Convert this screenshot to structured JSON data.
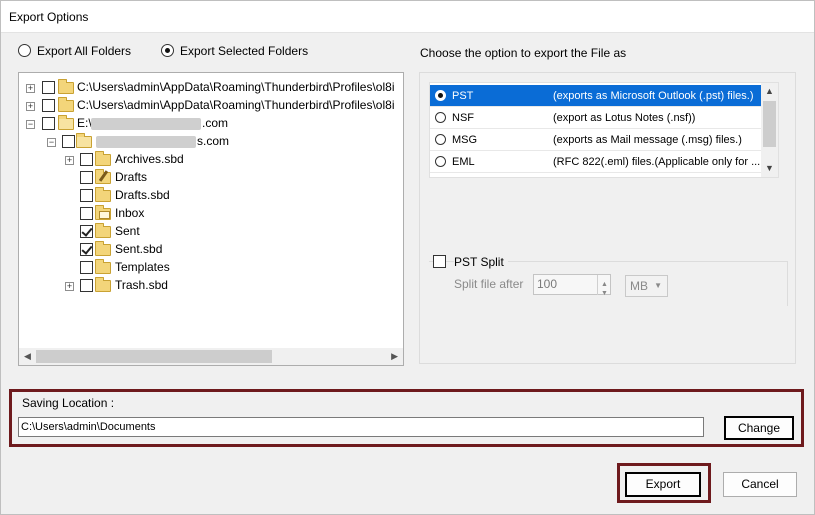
{
  "window": {
    "title": "Export Options"
  },
  "folders_mode": {
    "options": [
      {
        "label": "Export All Folders",
        "selected": false
      },
      {
        "label": "Export Selected Folders",
        "selected": true
      }
    ]
  },
  "tree": {
    "nodes": [
      {
        "label": "C:\\Users\\admin\\AppData\\Roaming\\Thunderbird\\Profiles\\ol8i",
        "checked": false,
        "expander": "+"
      },
      {
        "label": "C:\\Users\\admin\\AppData\\Roaming\\Thunderbird\\Profiles\\ol8i",
        "checked": false,
        "expander": "+"
      },
      {
        "label_prefix": "E:\\",
        "label_suffix": ".com",
        "checked": false,
        "expander": "−"
      },
      {
        "label_suffix": "s.com",
        "checked": false,
        "expander": "−"
      },
      {
        "label": "Archives.sbd",
        "checked": false,
        "expander": "+"
      },
      {
        "label": "Drafts",
        "checked": false
      },
      {
        "label": "Drafts.sbd",
        "checked": false
      },
      {
        "label": "Inbox",
        "checked": false
      },
      {
        "label": "Sent",
        "checked": true
      },
      {
        "label": "Sent.sbd",
        "checked": true
      },
      {
        "label": "Templates",
        "checked": false
      },
      {
        "label": "Trash.sbd",
        "checked": false,
        "expander": "+"
      }
    ]
  },
  "format": {
    "heading": "Choose the option to export the File as",
    "options": [
      {
        "name": "PST",
        "desc": "(exports as Microsoft Outlook (.pst) files.)",
        "selected": true
      },
      {
        "name": "NSF",
        "desc": "(export as Lotus Notes (.nsf))",
        "selected": false
      },
      {
        "name": "MSG",
        "desc": "(exports as Mail message (.msg) files.)",
        "selected": false
      },
      {
        "name": "EML",
        "desc": "(RFC 822(.eml) files.(Applicable only for ...",
        "selected": false
      }
    ]
  },
  "pst_split": {
    "label": "PST Split",
    "checked": false,
    "split_after_label": "Split file after",
    "value": "100",
    "unit": "MB"
  },
  "saving": {
    "label": "Saving Location :",
    "path": "C:\\Users\\admin\\Documents",
    "change_label": "Change"
  },
  "actions": {
    "export_label": "Export",
    "cancel_label": "Cancel"
  },
  "colors": {
    "selection": "#0a6cd6",
    "highlight_frame": "#6e1a1d"
  }
}
